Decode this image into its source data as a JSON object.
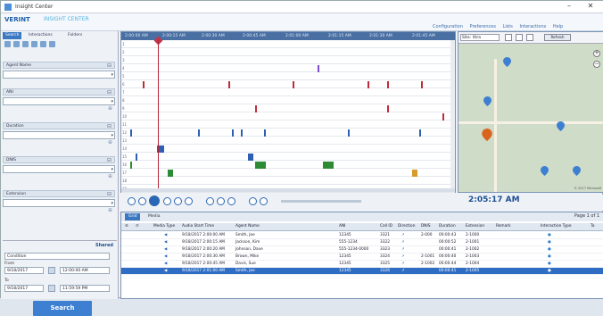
{
  "window": {
    "title": "Insight Center",
    "minimize": "–",
    "close": "✕"
  },
  "brand": {
    "name": "VERINT",
    "product": "INSIGHT CENTER"
  },
  "topnav": [
    "Configuration",
    "Preferences",
    "Lists",
    "Interactions",
    "Help"
  ],
  "left_tabs": [
    "Search",
    "Interactions",
    "Folders"
  ],
  "fields": [
    {
      "header": "Agent Name",
      "value": ""
    },
    {
      "header": "ANI",
      "value": ""
    },
    {
      "header": "Duration",
      "value": ""
    },
    {
      "header": "DNIS",
      "value": ""
    },
    {
      "header": "Extension",
      "value": ""
    }
  ],
  "search_section": {
    "label": "Shared",
    "condition": "Condition",
    "from_label": "From",
    "to_label": "To",
    "from_date": "9/18/2017",
    "from_time": "12:00:00 AM",
    "to_date": "9/18/2017",
    "to_time": "11:59:59 PM",
    "button": "Search"
  },
  "timeline_times": [
    "2:00:00 AM",
    "2:00:15 AM",
    "2:00:30 AM",
    "2:00:45 AM",
    "2:01:00 AM",
    "2:01:15 AM",
    "2:01:30 AM",
    "2:01:45 AM"
  ],
  "lanes": [
    "1",
    "2",
    "3",
    "4",
    "5",
    "6",
    "7",
    "8",
    "9",
    "10",
    "11",
    "12",
    "13",
    "14",
    "15",
    "16",
    "17",
    "18",
    "19"
  ],
  "map": {
    "select": "Site: Xtra",
    "button": "Refresh",
    "copyright": "© 2017 Microsoft"
  },
  "player": {
    "time": "2:05:17 AM"
  },
  "grid_tabs": [
    "Grid",
    "Media"
  ],
  "pager": {
    "page_label": "Page",
    "page": "1",
    "of": "of 1"
  },
  "columns": [
    "Media Type",
    "Audio Start Time",
    "Agent Name",
    "ANI",
    "Call ID",
    "Direction",
    "DNIS",
    "Duration",
    "Extension",
    "Remark",
    "Interaction Type",
    "Ta"
  ],
  "rows": [
    [
      "",
      "9/18/2017 2:00:00 AM",
      "Smith, Joe",
      "12345",
      "3321",
      "",
      "2-000",
      "00:00:43",
      "2-1000",
      "",
      "",
      ""
    ],
    [
      "",
      "9/18/2017 2:00:15 AM",
      "Jackson, Kim",
      "555-1234",
      "3322",
      "",
      "",
      "00:00:52",
      "2-1001",
      "",
      "",
      ""
    ],
    [
      "",
      "9/18/2017 2:00:20 AM",
      "Johnson, Dave",
      "555-1234-0000",
      "3323",
      "",
      "",
      "00:00:41",
      "2-1002",
      "",
      "",
      ""
    ],
    [
      "",
      "9/18/2017 2:00:30 AM",
      "Brown, Mike",
      "12345",
      "3324",
      "",
      "2-1001",
      "00:00:40",
      "2-1003",
      "",
      "",
      ""
    ],
    [
      "",
      "9/18/2017 2:00:45 AM",
      "Davis, Sue",
      "12345",
      "3325",
      "",
      "2-1002",
      "00:00:44",
      "2-1004",
      "",
      "",
      ""
    ],
    [
      "",
      "9/18/2017 2:01:00 AM",
      "Smith, Joe",
      "12345",
      "3326",
      "",
      "",
      "00:00:41",
      "2-1005",
      "",
      "",
      ""
    ]
  ]
}
